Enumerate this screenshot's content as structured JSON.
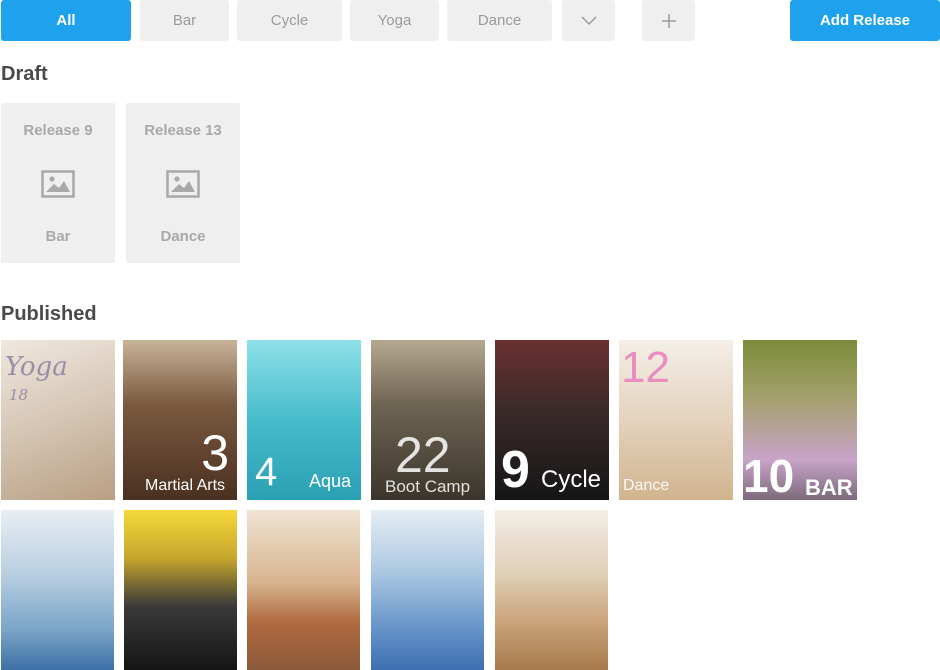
{
  "filters": {
    "tabs": [
      {
        "label": "All",
        "active": true
      },
      {
        "label": "Bar",
        "active": false
      },
      {
        "label": "Cycle",
        "active": false
      },
      {
        "label": "Yoga",
        "active": false
      },
      {
        "label": "Dance",
        "active": false
      }
    ],
    "more_icon": "chevron-down-icon",
    "add_icon": "plus-icon",
    "add_release_label": "Add Release"
  },
  "draft": {
    "title": "Draft",
    "items": [
      {
        "title": "Release 9",
        "category": "Bar",
        "icon": "image-placeholder-icon"
      },
      {
        "title": "Release 13",
        "category": "Dance",
        "icon": "image-placeholder-icon"
      }
    ]
  },
  "published": {
    "title": "Published",
    "tiles": [
      {
        "number": "18",
        "label": "Yoga",
        "color": "#c9b8a6"
      },
      {
        "number": "3",
        "label": "Martial Arts",
        "color": "#6b4a33"
      },
      {
        "number": "4",
        "label": "Aqua",
        "color": "#5fc2cf"
      },
      {
        "number": "22",
        "label": "Boot Camp",
        "color": "#6d6353"
      },
      {
        "number": "9",
        "label": "Cycle",
        "color": "#3a3535"
      },
      {
        "number": "12",
        "label": "Dance",
        "color": "#e8d9c8"
      },
      {
        "number": "10",
        "label": "BAR",
        "color": "#8d9a5a"
      },
      {
        "number": "",
        "label": "",
        "color": "#b6c7d6"
      },
      {
        "number": "",
        "label": "",
        "color": "#2b2b2b"
      },
      {
        "number": "",
        "label": "",
        "color": "#d9b99a"
      },
      {
        "number": "",
        "label": "",
        "color": "#a9c3d6"
      },
      {
        "number": "",
        "label": "",
        "color": "#dfc6a8"
      }
    ]
  },
  "colors": {
    "accent": "#1fa2ee",
    "button_bg": "#efefef",
    "muted_text": "#9b9b9b"
  }
}
